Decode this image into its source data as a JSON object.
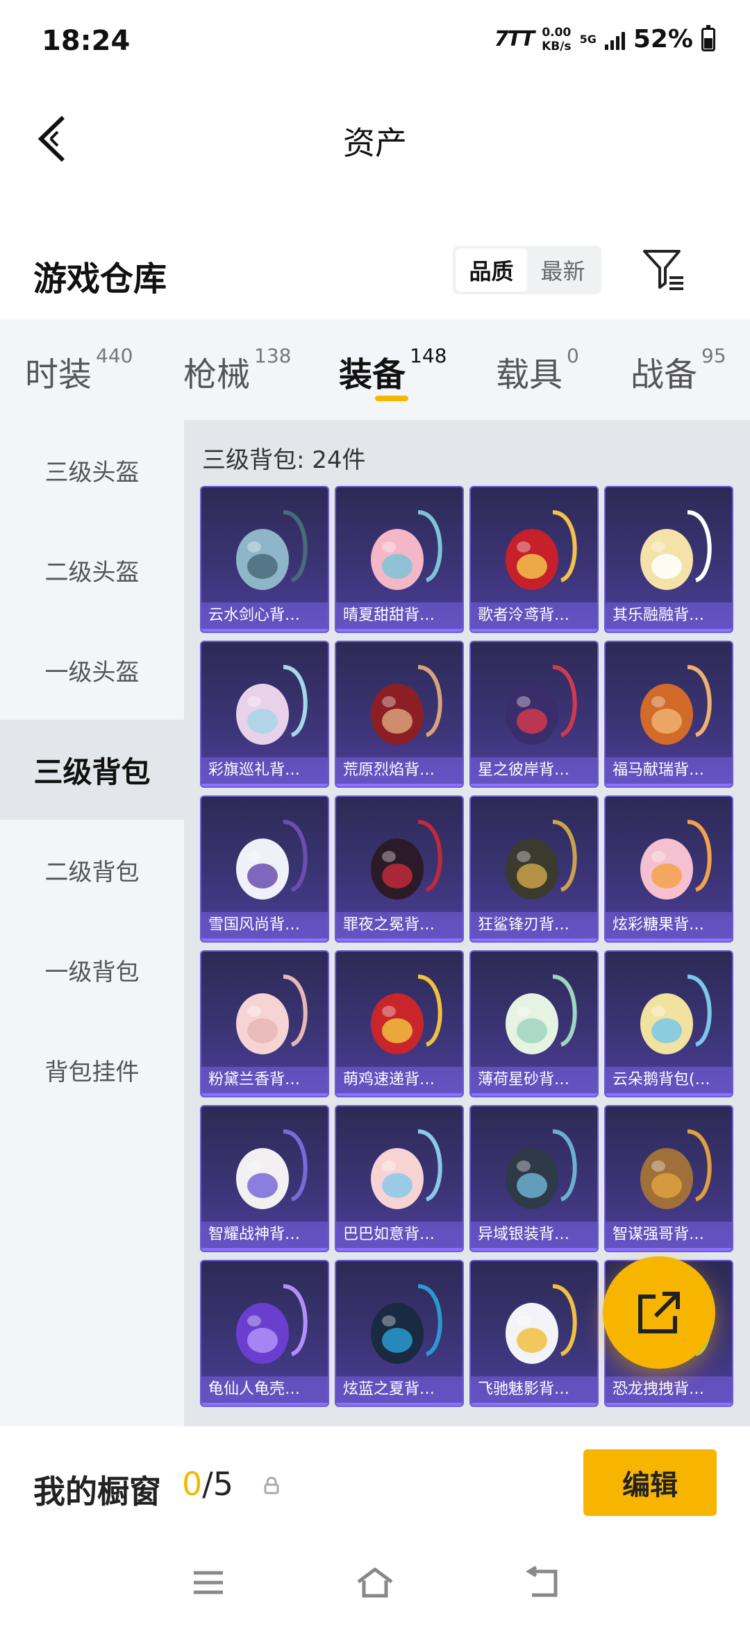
{
  "status_bar": {
    "time": "18:24",
    "carrier": "7TT",
    "speed_value": "0.00",
    "speed_unit": "KB/s",
    "network": "5G",
    "battery": "52%"
  },
  "header": {
    "title": "资产"
  },
  "warehouse": {
    "title": "游戏仓库",
    "sort_options": [
      "品质",
      "最新"
    ],
    "active_sort": "品质"
  },
  "categories": [
    {
      "label": "时装",
      "count": "440"
    },
    {
      "label": "枪械",
      "count": "138"
    },
    {
      "label": "装备",
      "count": "148"
    },
    {
      "label": "载具",
      "count": "0"
    },
    {
      "label": "战备",
      "count": "95"
    }
  ],
  "sidebar": {
    "items": [
      "三级头盔",
      "二级头盔",
      "一级头盔",
      "三级背包",
      "二级背包",
      "一级背包",
      "背包挂件"
    ],
    "active": "三级背包"
  },
  "content": {
    "heading": "三级背包: 24件",
    "items": [
      "云水剑心背…",
      "晴夏甜甜背…",
      "歌者泠鸢背…",
      "其乐融融背…",
      "彩旗巡礼背…",
      "荒原烈焰背…",
      "星之彼岸背…",
      "福马献瑞背…",
      "雪国风尚背…",
      "罪夜之冕背…",
      "狂鲨锋刃背…",
      "炫彩糖果背…",
      "粉黛兰香背…",
      "萌鸡速递背…",
      "薄荷星砂背…",
      "云朵鹅背包(…",
      "智耀战神背…",
      "巴巴如意背…",
      "异域银装背…",
      "智谋强哥背…",
      "龟仙人龟壳…",
      "炫蓝之夏背…",
      "飞驰魅影背…",
      "恐龙拽拽背…"
    ]
  },
  "showcase": {
    "title": "我的橱窗",
    "current": "0",
    "total": "/5",
    "edit_label": "编辑"
  },
  "colors": {
    "accent": "#f7b500",
    "card_bg": "#3b3475",
    "card_border": "#6e5ad8"
  }
}
